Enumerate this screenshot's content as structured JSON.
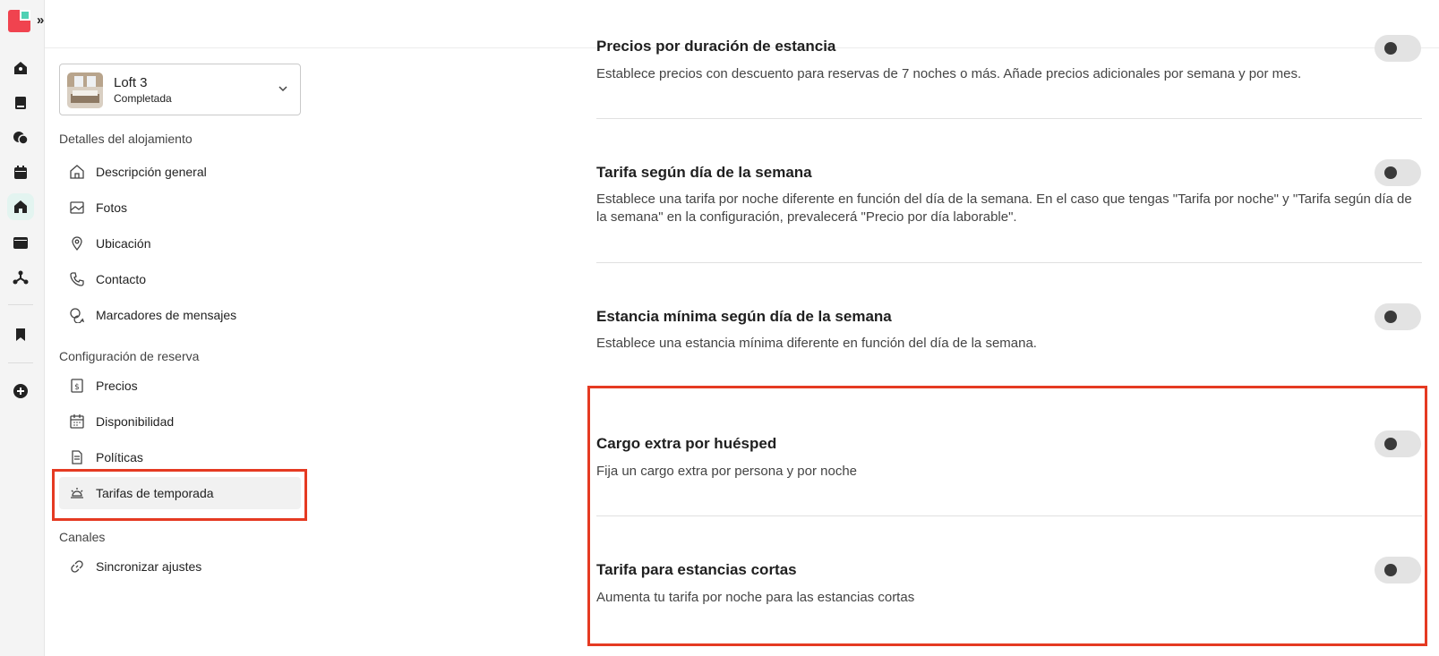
{
  "rail": {
    "expand_label": "»",
    "icons": [
      "home-icon",
      "book-icon",
      "chat-icon",
      "calendar-icon",
      "house-icon",
      "browser-icon",
      "network-icon",
      "bookmark-icon",
      "add-circle-icon"
    ]
  },
  "colors": {
    "accent": "#e53a22",
    "brand_red": "#f0434f",
    "brand_teal": "#4fd1b4",
    "active_rail": "#e3f4f0"
  },
  "property": {
    "name": "Loft 3",
    "status": "Completada"
  },
  "sidebar": {
    "section1": "Detalles del alojamiento",
    "items1": [
      {
        "label": "Descripción general",
        "icon": "house-outline-icon"
      },
      {
        "label": "Fotos",
        "icon": "image-icon"
      },
      {
        "label": "Ubicación",
        "icon": "location-pin-icon"
      },
      {
        "label": "Contacto",
        "icon": "phone-icon"
      },
      {
        "label": "Marcadores de mensajes",
        "icon": "chat-bubbles-icon"
      }
    ],
    "section2": "Configuración de reserva",
    "items2": [
      {
        "label": "Precios",
        "icon": "price-tag-icon"
      },
      {
        "label": "Disponibilidad",
        "icon": "calendar-grid-icon"
      },
      {
        "label": "Políticas",
        "icon": "document-icon"
      },
      {
        "label": "Tarifas de temporada",
        "icon": "sun-icon"
      }
    ],
    "section3": "Canales",
    "items3": [
      {
        "label": "Sincronizar ajustes",
        "icon": "link-icon"
      }
    ]
  },
  "main": {
    "rows": [
      {
        "title": "Precios por duración de estancia",
        "desc": "Establece precios con descuento para reservas de 7 noches o más. Añade precios adicionales por semana y por mes.",
        "enabled": false
      },
      {
        "title": "Tarifa según día de la semana",
        "desc": "Establece una tarifa por noche diferente en función del día de la semana. En el caso que tengas \"Tarifa por noche\" y \"Tarifa según día de la semana\" en la configuración, prevalecerá \"Precio por día laborable\".",
        "enabled": false
      },
      {
        "title": "Estancia mínima según día de la semana",
        "desc": "Establece una estancia mínima diferente en función del día de la semana.",
        "enabled": false
      },
      {
        "title": "Cargo extra por huésped",
        "desc": "Fija un cargo extra por persona y por noche",
        "enabled": false
      },
      {
        "title": "Tarifa para estancias cortas",
        "desc": "Aumenta tu tarifa por noche para las estancias cortas",
        "enabled": false
      }
    ]
  }
}
